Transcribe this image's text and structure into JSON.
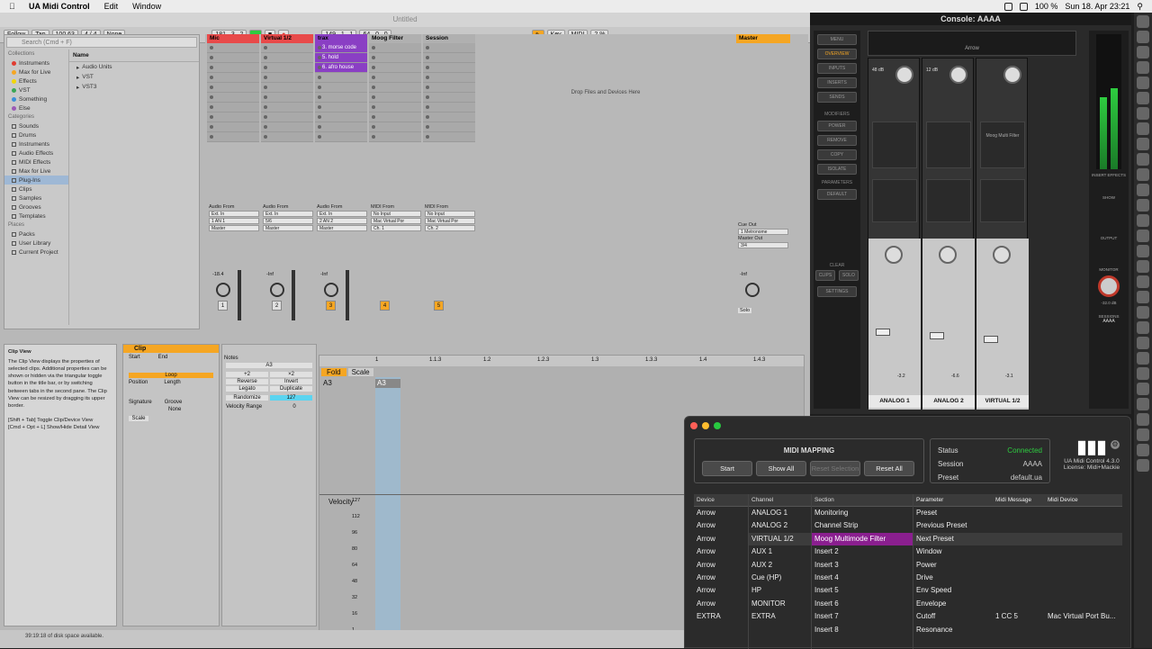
{
  "menubar": {
    "app_name": "UA Midi Control",
    "items": [
      "Edit",
      "Window"
    ],
    "status": {
      "battery": "100 %",
      "datetime": "Sun 18. Apr  23:21"
    }
  },
  "live": {
    "title": "Untitled",
    "toolbar": {
      "follow": "Follow",
      "tap": "Tap",
      "tempo": "100.63",
      "signature": "4 / 4",
      "quantize": "None",
      "position": "181 . 3 . 2",
      "loop_start": "149 . 1 . 1",
      "loop_length": "64 . 0 . 0",
      "key": "Key",
      "midi": "MIDI",
      "cpu": "2 %"
    },
    "browser": {
      "search_placeholder": "Search (Cmd + F)",
      "collections_header": "Collections",
      "collections": [
        {
          "label": "Instruments",
          "color": "#e03c31"
        },
        {
          "label": "Max for Live",
          "color": "#f5a623"
        },
        {
          "label": "Effects",
          "color": "#f2d600"
        },
        {
          "label": "VST",
          "color": "#3aa655"
        },
        {
          "label": "Something",
          "color": "#3b8fd9"
        },
        {
          "label": "Else",
          "color": "#9b59b6"
        }
      ],
      "categories_header": "Categories",
      "categories": [
        "Sounds",
        "Drums",
        "Instruments",
        "Audio Effects",
        "MIDI Effects",
        "Max for Live",
        "Plug-Ins",
        "Clips",
        "Samples",
        "Grooves",
        "Templates"
      ],
      "selected_category": "Plug-Ins",
      "places_header": "Places",
      "places": [
        "Packs",
        "User Library",
        "Current Project"
      ],
      "name_header": "Name",
      "name_items": [
        "Audio Units",
        "VST",
        "VST3"
      ]
    },
    "tracks": [
      {
        "name": "Mic",
        "color": "#e84a4a",
        "input_type": "Audio From",
        "input": "Ext. In",
        "channel": "1 AN 1",
        "output": "Master",
        "number": "1",
        "volume": "-18.4"
      },
      {
        "name": "Virtual 1/2",
        "color": "#e84a4a",
        "input_type": "Audio From",
        "input": "Ext. In",
        "channel": "5/6",
        "output": "Master",
        "number": "2",
        "volume": "-Inf"
      },
      {
        "name": "trax",
        "color": "#8a3fc4",
        "input_type": "Audio From",
        "input": "Ext. In",
        "channel": "2 AN 2",
        "output": "Master",
        "number": "3",
        "volume": "-Inf",
        "clips": [
          "3. morse code",
          "5. hold",
          "6. afro house"
        ]
      },
      {
        "name": "Moog Filter",
        "color": "#b0b0b0",
        "input_type": "MIDI From",
        "input": "No Input",
        "channel": "",
        "output": "Mac Virtual Por",
        "output_channel": "Ch. 1",
        "number": "4"
      },
      {
        "name": "Session",
        "color": "#b0b0b0",
        "input_type": "MIDI From",
        "input": "No Input",
        "channel": "",
        "output": "Mac Virtual Por",
        "output_channel": "Ch. 2",
        "number": "5"
      }
    ],
    "master": {
      "name": "Master",
      "cue_out": "Cue Out",
      "cue_value": "1 Metronome",
      "master_out": "Master Out",
      "master_value": "3/4",
      "volume": "-Inf",
      "solo": "Solo"
    },
    "drop_text": "Drop Files and Devices Here",
    "clip_view_info": {
      "title": "Clip View",
      "body": "The Clip View displays the properties of selected clips. Additional properties can be shown or hidden via the triangular toggle button in the title bar, or by switching between tabs in the second pane. The Clip View can be resized by dragging its upper border.",
      "shortcut1": "[Shift + Tab] Toggle Clip/Device View",
      "shortcut2": "[Cmd + Opt + L] Show/Hide Detail View"
    },
    "clip": {
      "title": "Clip",
      "start": "Start",
      "end": "End",
      "loop": "Loop",
      "position": "Position",
      "length": "Length",
      "signature": "Signature",
      "groove": "Groove",
      "groove_value": "None",
      "scale": "Scale"
    },
    "notes": {
      "title": "Notes",
      "note": "A3",
      "plus2": "+2",
      "x2": "×2",
      "reverse": "Reverse",
      "invert": "Invert",
      "legato": "Legato",
      "duplicate": "Duplicate",
      "randomize": "Randomize",
      "rand_value": "127",
      "velocity_range": "Velocity Range",
      "vel_value": "0"
    },
    "editor": {
      "fold": "Fold",
      "scale": "Scale",
      "note": "A3",
      "ruler": [
        "1",
        "1.1.3",
        "1.2",
        "1.2.3",
        "1.3",
        "1.3.3",
        "1.4",
        "1.4.3"
      ],
      "velocity_label": "Velocity",
      "velocity_ticks": [
        "127",
        "112",
        "96",
        "80",
        "64",
        "48",
        "32",
        "16",
        "1"
      ]
    },
    "status_text": "39:19:18 of disk space available."
  },
  "console": {
    "title": "Console: AAAA",
    "channel_label": "Arrow",
    "nav": [
      "MENU",
      "OVERVIEW",
      "INPUTS",
      "INSERTS",
      "SENDS"
    ],
    "modifiers_header": "MODIFIERS",
    "modifiers": [
      "POWER",
      "REMOVE",
      "COPY",
      "ISOLATE"
    ],
    "parameters_header": "PARAMETERS",
    "parameters": [
      "DEFAULT"
    ],
    "clear_header": "CLEAR",
    "clear": [
      "CLIPS",
      "SOLO"
    ],
    "settings": "SETTINGS",
    "channels": [
      {
        "name": "ANALOG 1",
        "gain": "48 dB",
        "level": "-3.2"
      },
      {
        "name": "ANALOG 2",
        "gain": "12 dB",
        "level": "-6.6"
      },
      {
        "name": "VIRTUAL 1/2",
        "insert": "Moog Multi Filter",
        "level": "-3.1"
      }
    ],
    "right": {
      "insert_effects": "INSERT EFFECTS",
      "show": "SHOW",
      "output": "OUTPUT",
      "monitor": "MONITOR",
      "monitor_level": "-32.0 dB",
      "sessions": "SESSIONS",
      "session_name": "AAAA"
    }
  },
  "midiwin": {
    "mapping_title": "MIDI MAPPING",
    "buttons": [
      "Start",
      "Show All",
      "Reset Selection",
      "Reset All"
    ],
    "status_label": "Status",
    "status_value": "Connected",
    "session_label": "Session",
    "session_value": "AAAA",
    "preset_label": "Preset",
    "preset_value": "default.ua",
    "brand_name": "UA Midi Control 4.3.0",
    "license": "License: Midi+Mackie",
    "headers": {
      "device": "Device",
      "channel": "Channel",
      "section": "Section",
      "parameter": "Parameter",
      "midi_message": "Midi Message",
      "midi_device": "Midi Device"
    },
    "devices": [
      "Arrow",
      "Arrow",
      "Arrow",
      "Arrow",
      "Arrow",
      "Arrow",
      "Arrow",
      "Arrow",
      "EXTRA"
    ],
    "channels": [
      "ANALOG 1",
      "ANALOG 2",
      "VIRTUAL 1/2",
      "AUX 1",
      "AUX 2",
      "Cue (HP)",
      "HP",
      "MONITOR",
      "EXTRA"
    ],
    "sections": [
      "Monitoring",
      "Channel Strip",
      "Moog Multimode Filter",
      "Insert 2",
      "Insert 3",
      "Insert 4",
      "Insert 5",
      "Insert 6",
      "Insert 7",
      "Insert 8"
    ],
    "selected_section": 2,
    "parameters": [
      {
        "name": "Preset",
        "msg": "",
        "dev": ""
      },
      {
        "name": "Previous Preset",
        "msg": "",
        "dev": ""
      },
      {
        "name": "Next Preset",
        "msg": "",
        "dev": ""
      },
      {
        "name": "Window",
        "msg": "",
        "dev": ""
      },
      {
        "name": "Power",
        "msg": "",
        "dev": ""
      },
      {
        "name": "Drive",
        "msg": "",
        "dev": ""
      },
      {
        "name": "Env Speed",
        "msg": "",
        "dev": ""
      },
      {
        "name": "Envelope",
        "msg": "",
        "dev": ""
      },
      {
        "name": "Cutoff",
        "msg": "1 CC 5",
        "dev": "Mac Virtual Port Bu..."
      },
      {
        "name": "Resonance",
        "msg": "",
        "dev": ""
      }
    ]
  }
}
